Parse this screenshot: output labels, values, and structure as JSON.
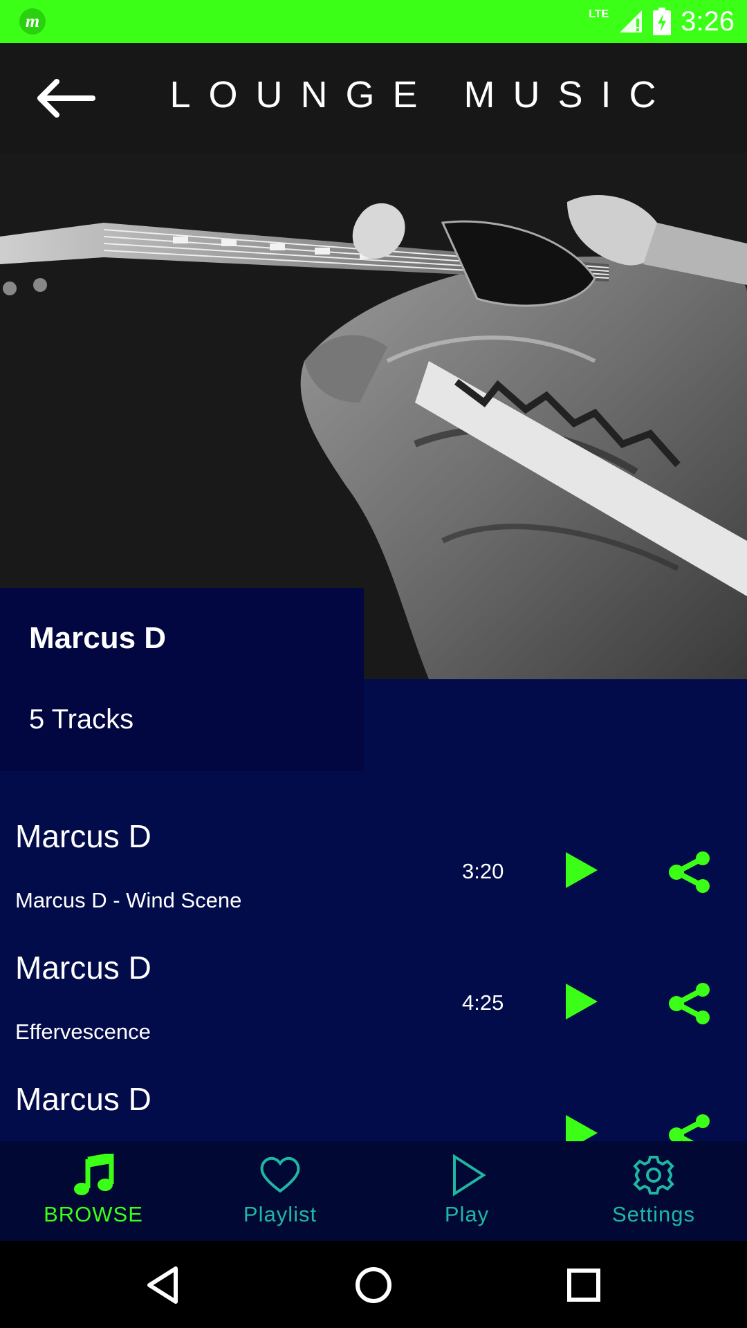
{
  "status_bar": {
    "time": "3:26",
    "network": "LTE",
    "background": "#3cff17"
  },
  "header": {
    "title": "LOUNGE MUSIC",
    "back_icon": "arrow-left-icon"
  },
  "hero": {
    "description_icon": "guitar-player-photo"
  },
  "artist_card": {
    "name": "Marcus D",
    "tracks_label": "5 Tracks"
  },
  "tracks": [
    {
      "artist": "Marcus D",
      "title": "Marcus D - Wind Scene",
      "duration": "3:20"
    },
    {
      "artist": "Marcus D",
      "title": "Effervescence",
      "duration": "4:25"
    },
    {
      "artist": "Marcus D",
      "title": "",
      "duration": ""
    }
  ],
  "bottom_nav": {
    "items": [
      {
        "label": "BROWSE",
        "icon": "music-note-icon",
        "active": true
      },
      {
        "label": "Playlist",
        "icon": "heart-icon",
        "active": false
      },
      {
        "label": "Play",
        "icon": "play-icon",
        "active": false
      },
      {
        "label": "Settings",
        "icon": "gear-icon",
        "active": false
      }
    ]
  },
  "colors": {
    "accent": "#3cff17",
    "list_bg": "#030c4a",
    "card_bg": "#020742",
    "nav_inactive": "#1fb6a4"
  }
}
